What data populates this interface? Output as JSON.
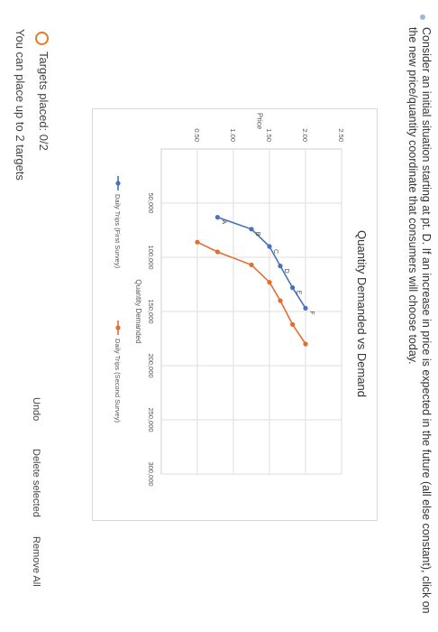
{
  "question": "Consider an initial situation starting at pt. D. If an increase in price is expected in the future (all else constant), click on the new price/quantity coordinate that consumers will choose today.",
  "chart_data": {
    "type": "line",
    "title": "Quantity Demanded vs Demand",
    "xlabel": "Quantity Demanded",
    "ylabel": "Price",
    "xlim": [
      0,
      300000
    ],
    "ylim": [
      0,
      2.5
    ],
    "x_ticks": [
      "50,000",
      "100,000",
      "150,000",
      "200,000",
      "250,000",
      "300,000"
    ],
    "y_ticks": [
      "2.50",
      "2.00",
      "1.50",
      "1.00",
      "0.50"
    ],
    "grid": true,
    "legend_position": "bottom",
    "series": [
      {
        "name": "Daily Trips (First Survey)",
        "color": "#4a72b8",
        "points": [
          {
            "label": "F",
            "x": 147000,
            "y": 2.0
          },
          {
            "label": "E",
            "x": 128000,
            "y": 1.82
          },
          {
            "label": "D",
            "x": 108000,
            "y": 1.65
          },
          {
            "label": "C",
            "x": 90000,
            "y": 1.5
          },
          {
            "label": "B",
            "x": 74000,
            "y": 1.25
          },
          {
            "label": "A",
            "x": 63000,
            "y": 0.78
          }
        ]
      },
      {
        "name": "Daily Trips (Second Survey)",
        "color": "#e36c2f",
        "points": [
          {
            "label": "",
            "x": 180000,
            "y": 2.0
          },
          {
            "label": "",
            "x": 162000,
            "y": 1.82
          },
          {
            "label": "",
            "x": 140000,
            "y": 1.65
          },
          {
            "label": "",
            "x": 123000,
            "y": 1.5
          },
          {
            "label": "",
            "x": 107000,
            "y": 1.25
          },
          {
            "label": "",
            "x": 95000,
            "y": 0.78
          },
          {
            "label": "",
            "x": 86000,
            "y": 0.5
          }
        ]
      }
    ]
  },
  "status": {
    "targets_placed": "Targets placed: 0/2",
    "note": "You can place up to 2 targets",
    "icon": "circle-outline-icon",
    "color": "#e07b2c"
  },
  "actions": {
    "undo": "Undo",
    "delete_selected": "Delete selected",
    "remove_all": "Remove All"
  }
}
